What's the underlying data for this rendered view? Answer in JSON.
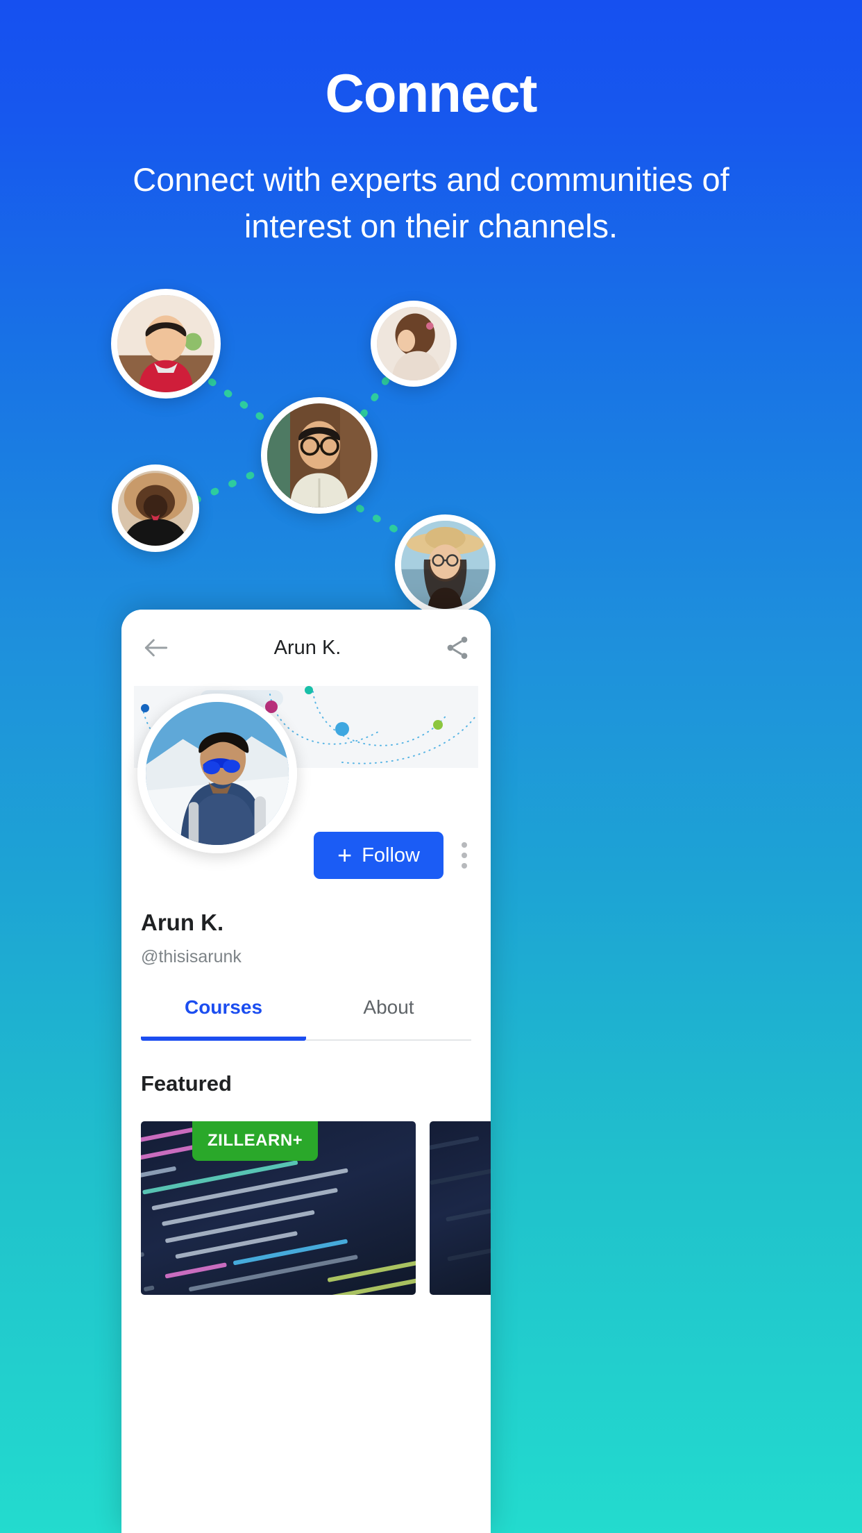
{
  "hero": {
    "title": "Connect",
    "subtitle": "Connect with experts and communities of interest on their channels."
  },
  "colors": {
    "bg_top": "#1650F0",
    "bg_mid": "#1E95DC",
    "bg_bottom": "#23DBCE",
    "accent_blue": "#1B5CF5",
    "tab_active": "#1B4DF0",
    "connector_teal": "#2ECC9E",
    "badge_green": "#2AA82A",
    "cover_dot_magenta": "#B9307C",
    "cover_dot_blue": "#3EA7E0",
    "cover_dot_green": "#8CC63F",
    "cover_dot_navy": "#1565C0",
    "cover_dot_teal": "#18BFA8"
  },
  "network": {
    "avatars": [
      {
        "name": "avatar-woman-red-shirt"
      },
      {
        "name": "avatar-woman-updo-hair"
      },
      {
        "name": "avatar-man-glasses-center"
      },
      {
        "name": "avatar-woman-fur-hood"
      },
      {
        "name": "avatar-woman-straw-hat"
      }
    ]
  },
  "phone": {
    "appbar": {
      "back_icon": "arrow-left-icon",
      "title": "Arun K.",
      "share_icon": "share-icon"
    },
    "profile": {
      "avatar_icon": "profile-avatar",
      "name": "Arun K.",
      "handle": "@thisisarunk",
      "follow_label": "Follow",
      "follow_plus": "+",
      "more_icon": "kebab-menu-icon"
    },
    "tabs": [
      {
        "label": "Courses",
        "active": true
      },
      {
        "label": "About",
        "active": false
      }
    ],
    "featured": {
      "heading": "Featured",
      "cards": [
        {
          "badge": "ZILLEARN+",
          "thumb": "code-editor-thumbnail"
        },
        {
          "badge": "",
          "thumb": "dark-thumbnail"
        }
      ]
    }
  }
}
